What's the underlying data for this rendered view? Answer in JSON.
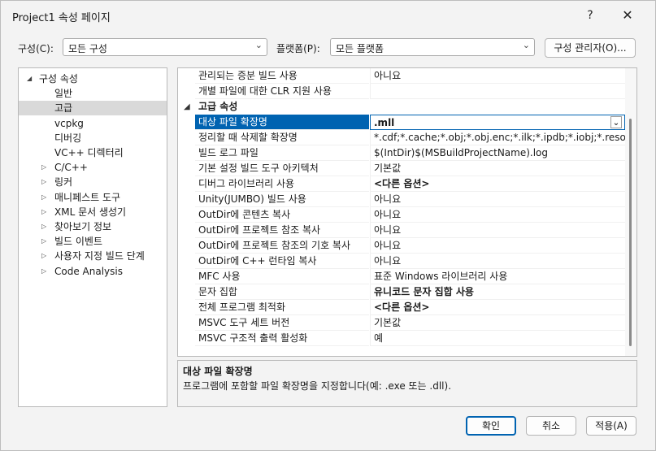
{
  "window": {
    "title": "Project1 속성 페이지",
    "help": "?",
    "close": "✕"
  },
  "config": {
    "config_label": "구성(C):",
    "config_value": "모든 구성",
    "platform_label": "플랫폼(P):",
    "platform_value": "모든 플랫폼",
    "manager_label": "구성 관리자(O)..."
  },
  "tree": [
    {
      "label": "구성 속성",
      "arrow": "◢",
      "depth": 0,
      "selected": false
    },
    {
      "label": "일반",
      "arrow": "",
      "depth": 1,
      "selected": false
    },
    {
      "label": "고급",
      "arrow": "",
      "depth": 1,
      "selected": true
    },
    {
      "label": "vcpkg",
      "arrow": "",
      "depth": 1,
      "selected": false
    },
    {
      "label": "디버깅",
      "arrow": "",
      "depth": 1,
      "selected": false
    },
    {
      "label": "VC++ 디렉터리",
      "arrow": "",
      "depth": 1,
      "selected": false
    },
    {
      "label": "C/C++",
      "arrow": "▷",
      "depth": 1,
      "selected": false
    },
    {
      "label": "링커",
      "arrow": "▷",
      "depth": 1,
      "selected": false
    },
    {
      "label": "매니페스트 도구",
      "arrow": "▷",
      "depth": 1,
      "selected": false
    },
    {
      "label": "XML 문서 생성기",
      "arrow": "▷",
      "depth": 1,
      "selected": false
    },
    {
      "label": "찾아보기 정보",
      "arrow": "▷",
      "depth": 1,
      "selected": false
    },
    {
      "label": "빌드 이벤트",
      "arrow": "▷",
      "depth": 1,
      "selected": false
    },
    {
      "label": "사용자 지정 빌드 단계",
      "arrow": "▷",
      "depth": 1,
      "selected": false
    },
    {
      "label": "Code Analysis",
      "arrow": "▷",
      "depth": 1,
      "selected": false
    }
  ],
  "grid": {
    "top_rows": [
      {
        "name": "관리되는 증분 빌드 사용",
        "value": "아니요",
        "bold": false
      },
      {
        "name": "개별 파일에 대한 CLR 지원 사용",
        "value": "",
        "bold": false
      }
    ],
    "category": {
      "arrow": "◢",
      "label": "고급 속성"
    },
    "rows": [
      {
        "name": "대상 파일 확장명",
        "value": ".mll",
        "bold": true,
        "selected": true
      },
      {
        "name": "정리할 때 삭제할 확장명",
        "value": "*.cdf;*.cache;*.obj;*.obj.enc;*.ilk;*.ipdb;*.iobj;*.resources;*.t",
        "bold": false
      },
      {
        "name": "빌드 로그 파일",
        "value": "$(IntDir)$(MSBuildProjectName).log",
        "bold": false
      },
      {
        "name": "기본 설정 빌드 도구 아키텍처",
        "value": "기본값",
        "bold": false
      },
      {
        "name": "디버그 라이브러리 사용",
        "value": "<다른 옵션>",
        "bold": true
      },
      {
        "name": "Unity(JUMBO) 빌드 사용",
        "value": "아니요",
        "bold": false
      },
      {
        "name": "OutDir에 콘텐츠 복사",
        "value": "아니요",
        "bold": false
      },
      {
        "name": "OutDir에 프로젝트 참조 복사",
        "value": "아니요",
        "bold": false
      },
      {
        "name": "OutDir에 프로젝트 참조의 기호 복사",
        "value": "아니요",
        "bold": false
      },
      {
        "name": "OutDir에 C++ 런타임 복사",
        "value": "아니요",
        "bold": false
      },
      {
        "name": "MFC 사용",
        "value": "표준 Windows 라이브러리 사용",
        "bold": false
      },
      {
        "name": "문자 집합",
        "value": "유니코드 문자 집합 사용",
        "bold": true
      },
      {
        "name": "전체 프로그램 최적화",
        "value": "<다른 옵션>",
        "bold": true
      },
      {
        "name": "MSVC 도구 세트 버전",
        "value": "기본값",
        "bold": false
      },
      {
        "name": "MSVC 구조적 출력 활성화",
        "value": "예",
        "bold": false
      }
    ]
  },
  "description": {
    "title": "대상 파일 확장명",
    "text": "프로그램에 포함할 파일 확장명을 지정합니다(예: .exe 또는 .dll)."
  },
  "buttons": {
    "ok": "확인",
    "cancel": "취소",
    "apply": "적용(A)"
  },
  "icons": {
    "chevron": "chevron-down-icon",
    "expand": "triangle-right-icon",
    "collapse": "triangle-down-icon"
  },
  "colors": {
    "selection": "#0063b1",
    "tree_selection": "#d9d9d9"
  }
}
